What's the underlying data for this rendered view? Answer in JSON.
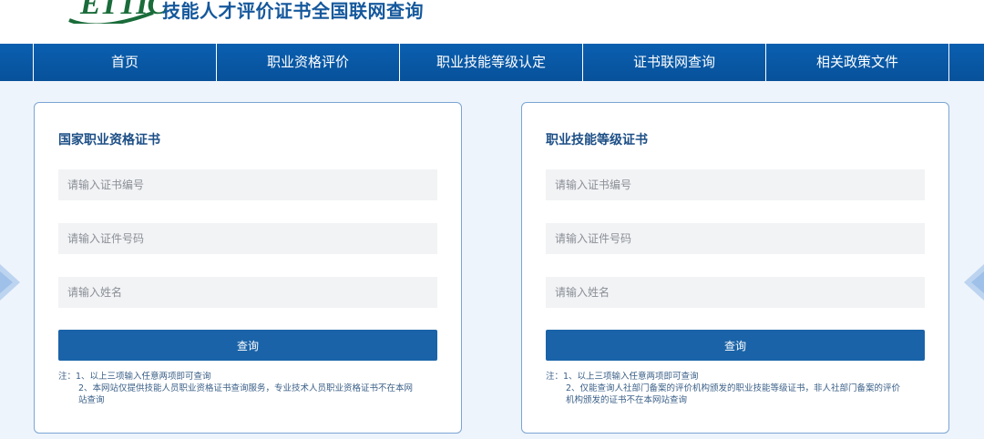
{
  "header": {
    "logo_text": "ETTIC",
    "site_title": "技能人才评价证书全国联网查询"
  },
  "nav": {
    "items": [
      {
        "label": "首页"
      },
      {
        "label": "职业资格评价"
      },
      {
        "label": "职业技能等级认定"
      },
      {
        "label": "证书联网查询"
      },
      {
        "label": "相关政策文件"
      }
    ]
  },
  "panels": [
    {
      "title": "国家职业资格证书",
      "placeholders": {
        "cert_no": "请输入证书编号",
        "id_no": "请输入证件号码",
        "name": "请输入姓名"
      },
      "button_label": "查询",
      "notes": [
        "注：1、以上三项输入任意两项即可查询",
        "2、本网站仅提供技能人员职业资格证书查询服务，专业技术人员职业资格证书不在本网",
        "站查询"
      ]
    },
    {
      "title": "职业技能等级证书",
      "placeholders": {
        "cert_no": "请输入证书编号",
        "id_no": "请输入证件号码",
        "name": "请输入姓名"
      },
      "button_label": "查询",
      "notes": [
        "注：1、以上三项输入任意两项即可查询",
        "2、仅能查询人社部门备案的评价机构颁发的职业技能等级证书，非人社部门备案的评价",
        "机构颁发的证书不在本网站查询"
      ]
    }
  ],
  "colors": {
    "brand_blue": "#0a5fb0",
    "button_blue": "#1a63a8",
    "logo_green": "#1a6c3a"
  }
}
